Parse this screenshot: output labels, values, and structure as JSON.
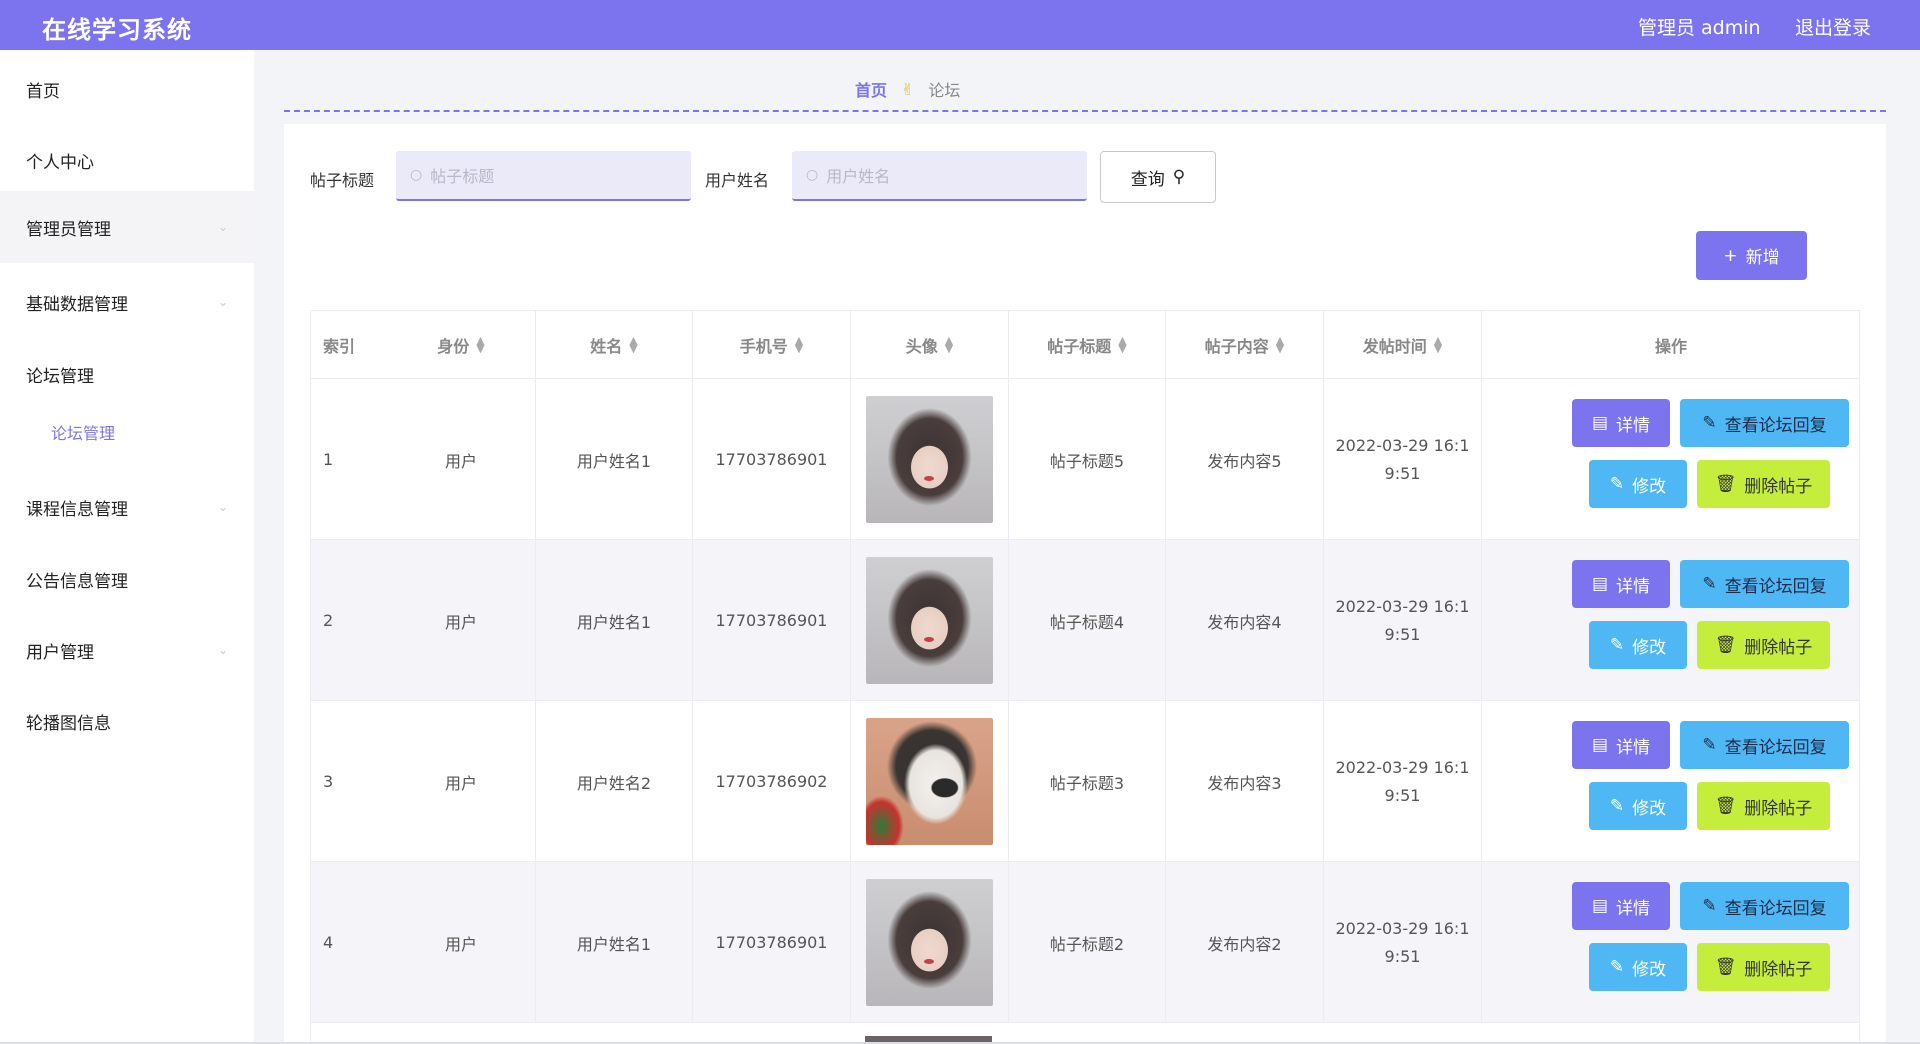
{
  "header": {
    "app_title": "在线学习系统",
    "admin_label": "管理员 admin",
    "logout_label": "退出登录"
  },
  "sidebar": {
    "items": [
      {
        "label": "首页"
      },
      {
        "label": "个人中心"
      },
      {
        "label": "管理员管理"
      },
      {
        "label": "基础数据管理"
      },
      {
        "label": "论坛管理"
      },
      {
        "label": "论坛管理"
      },
      {
        "label": "课程信息管理"
      },
      {
        "label": "公告信息管理"
      },
      {
        "label": "用户管理"
      },
      {
        "label": "轮播图信息"
      }
    ]
  },
  "breadcrumb": {
    "home": "首页",
    "current": "论坛"
  },
  "search": {
    "title_label": "帖子标题",
    "title_placeholder": "帖子标题",
    "user_label": "用户姓名",
    "user_placeholder": "用户姓名",
    "query_label": "查询",
    "add_label": "新增"
  },
  "table": {
    "columns": [
      "索引",
      "身份",
      "姓名",
      "手机号",
      "头像",
      "帖子标题",
      "帖子内容",
      "发帖时间",
      "操作"
    ],
    "rows": [
      {
        "index": "1",
        "identity": "用户",
        "name": "用户姓名1",
        "phone": "17703786901",
        "avatar": "girl",
        "title": "帖子标题5",
        "content": "发布内容5",
        "time_line1": "2022-03-29 16:1",
        "time_line2": "9:51"
      },
      {
        "index": "2",
        "identity": "用户",
        "name": "用户姓名1",
        "phone": "17703786901",
        "avatar": "girl",
        "title": "帖子标题4",
        "content": "发布内容4",
        "time_line1": "2022-03-29 16:1",
        "time_line2": "9:51"
      },
      {
        "index": "3",
        "identity": "用户",
        "name": "用户姓名2",
        "phone": "17703786902",
        "avatar": "cat",
        "title": "帖子标题3",
        "content": "发布内容3",
        "time_line1": "2022-03-29 16:1",
        "time_line2": "9:51"
      },
      {
        "index": "4",
        "identity": "用户",
        "name": "用户姓名1",
        "phone": "17703786901",
        "avatar": "girl",
        "title": "帖子标题2",
        "content": "发布内容2",
        "time_line1": "2022-03-29 16:1",
        "time_line2": "9:51"
      }
    ],
    "actions": {
      "detail": "详情",
      "view_reply": "查看论坛回复",
      "edit": "修改",
      "delete": "删除帖子"
    }
  },
  "colors": {
    "primary": "#7c74ee",
    "info": "#4fb8f4",
    "warning": "#c5ed3c"
  }
}
